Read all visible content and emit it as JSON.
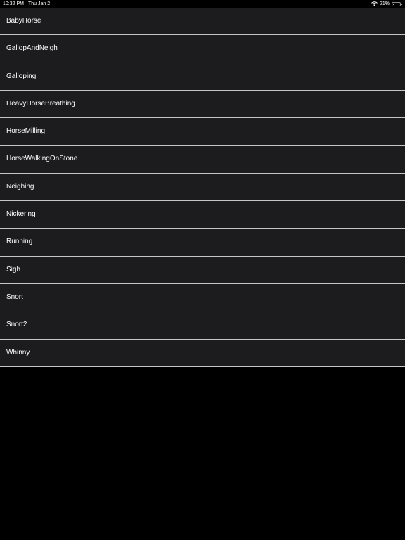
{
  "status_bar": {
    "time": "10:32 PM",
    "date": "Thu Jan 2",
    "battery_percent": "21%",
    "battery_level": 0.21,
    "wifi_icon": "wifi-icon",
    "battery_icon": "battery-icon"
  },
  "sounds": {
    "items": [
      {
        "label": "BabyHorse"
      },
      {
        "label": "GallopAndNeigh"
      },
      {
        "label": "Galloping"
      },
      {
        "label": "HeavyHorseBreathing"
      },
      {
        "label": "HorseMilling"
      },
      {
        "label": "HorseWalkingOnStone"
      },
      {
        "label": "Neighing"
      },
      {
        "label": "Nickering"
      },
      {
        "label": "Running"
      },
      {
        "label": "Sigh"
      },
      {
        "label": "Snort"
      },
      {
        "label": "Snort2"
      },
      {
        "label": "Whinny"
      }
    ]
  },
  "colors": {
    "background": "#000000",
    "row_background": "#1c1c1e",
    "separator": "#c6c6c8",
    "text": "#ffffff"
  }
}
